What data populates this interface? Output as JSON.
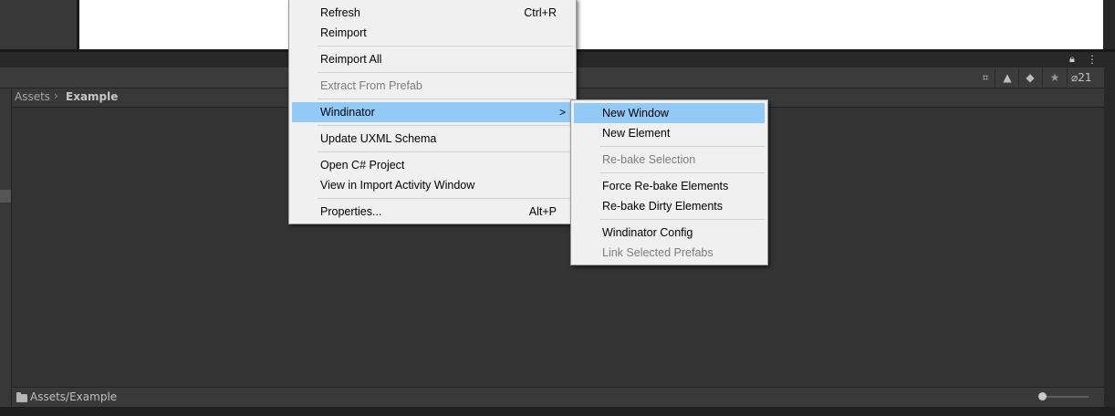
{
  "breadcrumb": {
    "root": "Assets",
    "current": "Example"
  },
  "toolbar": {
    "hidden_packages_count": "21",
    "search_value": ""
  },
  "status_bar": {
    "path": "Assets/Example"
  },
  "icons": {
    "lock": "lock-icon",
    "more": "more-options-icon",
    "search": "search-icon",
    "search_by_type": "search-by-type-icon",
    "search_by_label": "label-icon",
    "favorite": "star-icon",
    "hidden_packages": "eye-slash-icon",
    "folder": "folder-icon"
  },
  "context_menu": {
    "items": [
      {
        "label": "Refresh",
        "shortcut": "Ctrl+R",
        "enabled": true
      },
      {
        "label": "Reimport",
        "shortcut": "",
        "enabled": true
      },
      {
        "label": "Reimport All",
        "shortcut": "",
        "enabled": true
      },
      {
        "label": "Extract From Prefab",
        "shortcut": "",
        "enabled": false
      },
      {
        "label": "Windinator",
        "shortcut": "",
        "enabled": true,
        "submenu": true
      },
      {
        "label": "Update UXML Schema",
        "shortcut": "",
        "enabled": true
      },
      {
        "label": "Open C# Project",
        "shortcut": "",
        "enabled": true
      },
      {
        "label": "View in Import Activity Window",
        "shortcut": "",
        "enabled": true
      },
      {
        "label": "Properties...",
        "shortcut": "Alt+P",
        "enabled": true
      }
    ],
    "submenu_arrow": ">"
  },
  "windinator_menu": {
    "items": [
      {
        "label": "New Window",
        "enabled": true
      },
      {
        "label": "New Element",
        "enabled": true
      },
      {
        "label": "Re-bake Selection",
        "enabled": false
      },
      {
        "label": "Force Re-bake Elements",
        "enabled": true
      },
      {
        "label": "Re-bake Dirty Elements",
        "enabled": true
      },
      {
        "label": "Windinator Config",
        "enabled": true
      },
      {
        "label": "Link Selected Prefabs",
        "enabled": false
      }
    ]
  },
  "colors": {
    "menu_background": "#f0f0f0",
    "menu_highlight": "#91c9f7",
    "disabled_text": "#7d7d7d",
    "editor_dark": "#383838"
  }
}
